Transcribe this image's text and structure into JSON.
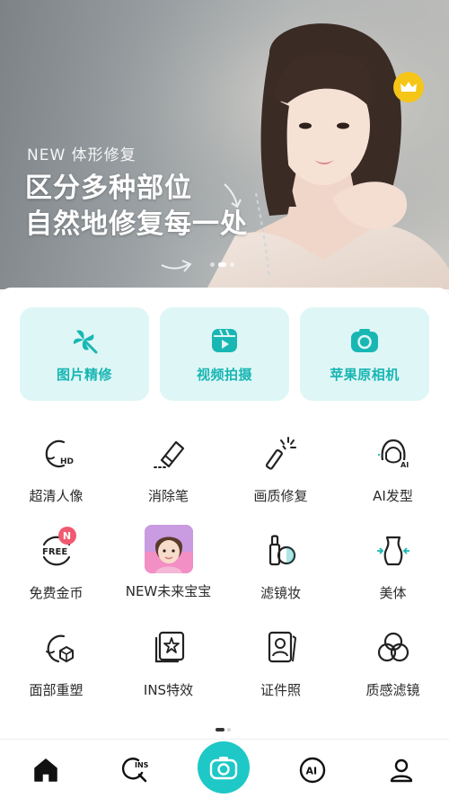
{
  "banner": {
    "subtitle": "NEW 体形修复",
    "title_line1": "区分多种部位",
    "title_line2": "自然地修复每一处",
    "crown_icon": "crown-icon",
    "slides": 3,
    "active_slide": 2
  },
  "cards": [
    {
      "label": "图片精修",
      "icon": "pinwheel-icon"
    },
    {
      "label": "视频拍摄",
      "icon": "video-camera-icon"
    },
    {
      "label": "苹果原相机",
      "icon": "camera-icon"
    }
  ],
  "tools": [
    {
      "label": "超清人像",
      "icon": "hd-portrait-icon"
    },
    {
      "label": "消除笔",
      "icon": "eraser-icon"
    },
    {
      "label": "画质修复",
      "icon": "magic-wand-icon"
    },
    {
      "label": "AI发型",
      "icon": "ai-hairstyle-icon"
    },
    {
      "label": "免费金币",
      "icon": "free-coin-icon",
      "badge": "N"
    },
    {
      "label": "NEW未来宝宝",
      "icon": "baby-thumbnail"
    },
    {
      "label": "滤镜妆",
      "icon": "makeup-icon"
    },
    {
      "label": "美体",
      "icon": "body-shape-icon"
    },
    {
      "label": "面部重塑",
      "icon": "face-reshape-icon"
    },
    {
      "label": "INS特效",
      "icon": "ins-effect-icon"
    },
    {
      "label": "证件照",
      "icon": "id-photo-icon"
    },
    {
      "label": "质感滤镜",
      "icon": "texture-filter-icon"
    }
  ],
  "free_coin_text": "FREE",
  "hd_text": "HD",
  "ai_text": "AI",
  "nav": {
    "items": [
      "home-icon",
      "ins-search-icon",
      "camera-icon",
      "ai-icon",
      "profile-icon"
    ],
    "ins_text": "INS",
    "ai_text": "AI"
  },
  "colors": {
    "accent": "#1ec8c6",
    "card_bg": "#dff6f6",
    "card_text": "#17b6b3",
    "badge": "#f05a70",
    "crown": "#f5c518"
  }
}
